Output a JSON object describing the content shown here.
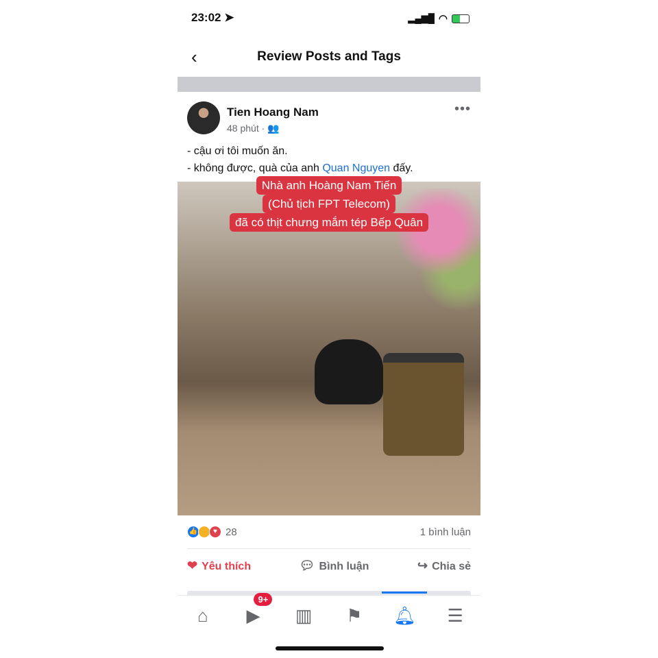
{
  "status": {
    "time": "23:02",
    "location_icon": "location-arrow-icon",
    "signal_icon": "signal-icon",
    "wifi_icon": "wifi-icon",
    "battery_icon": "battery-charging-icon"
  },
  "header": {
    "title": "Review Posts and Tags",
    "back_icon": "chevron-left-icon"
  },
  "post": {
    "author": "Tien Hoang Nam",
    "time": "48 phút",
    "audience_icon": "friends-icon",
    "lines": {
      "l1": "- cậu ơi tôi muốn ăn.",
      "l2_before": "- không được, quà của anh ",
      "mention": "Quan Nguyen",
      "l2_after": " đấy."
    },
    "image_caption": {
      "l1": "Nhà anh Hoàng Nam Tiến",
      "l2": "(Chủ tịch FPT Telecom)",
      "l3": "đã có thịt chưng mắm tép Bếp Quân"
    },
    "reaction_count": "28",
    "comment_count": "1 bình luận",
    "actions": {
      "like": "Yêu thích",
      "comment": "Bình luận",
      "share": "Chia sẻ"
    }
  },
  "tabbar": {
    "video_badge": "9+",
    "active": "notifications"
  },
  "colors": {
    "accent": "#1877f2",
    "love": "#e0414f",
    "mention": "#1a6fd1",
    "caption_bg": "#d9343f"
  }
}
